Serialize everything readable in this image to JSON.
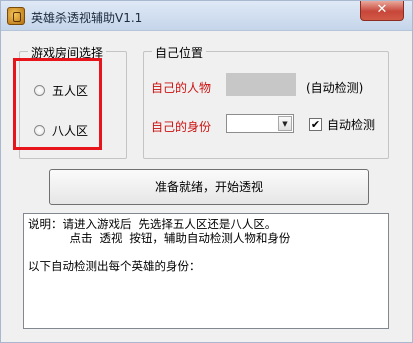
{
  "window": {
    "title": "英雄杀透视辅助V1.1",
    "close_glyph": "✕"
  },
  "room_group": {
    "legend": "游戏房间选择",
    "options": [
      {
        "label": "五人区"
      },
      {
        "label": "八人区"
      }
    ]
  },
  "position_group": {
    "legend": "自己位置",
    "character_label": "自己的人物",
    "character_hint": "(自动检测)",
    "identity_label": "自己的身份",
    "identity_select_value": "",
    "auto_detect_label": "自动检测",
    "auto_detect_checked": true,
    "check_glyph": "✔",
    "arrow_glyph": "▼"
  },
  "start_button": {
    "label": "准备就绪，开始透视"
  },
  "info_text": "说明：请进入游戏后 先选择五人区还是八人区。\n      点击 透视 按钮，辅助自动检测人物和身份\n\n以下自动检测出每个英雄的身份："
}
